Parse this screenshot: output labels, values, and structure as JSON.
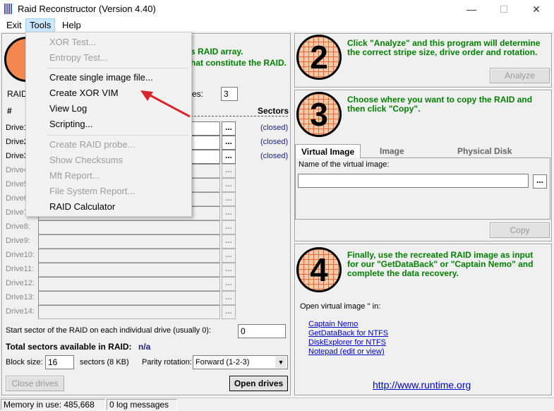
{
  "window": {
    "title": "Raid Reconstructor (Version 4.40)",
    "minimize": "—",
    "maximize": "☐",
    "close": "✕"
  },
  "menu": [
    "Exit",
    "Tools",
    "Help"
  ],
  "tools_menu": {
    "group1": [
      "XOR Test...",
      "Entropy Test..."
    ],
    "group2": [
      "Create single image file...",
      "Create XOR VIM",
      "View Log",
      "Scripting..."
    ],
    "group3": [
      "Create RAID probe...",
      "Show Checksums",
      "Mft Report...",
      "File System Report..."
    ],
    "calc": "RAID Calculator"
  },
  "step1": {
    "text_line1": "s RAID array.",
    "text_line2": "hat constitute the RAID.",
    "raid_label": "RAID",
    "drives_label": "es:",
    "drives_count": "3",
    "col_hash": "#",
    "col_sectors": "Sectors",
    "drives": [
      {
        "label": "Drive1",
        "status": "(closed)"
      },
      {
        "label": "Drive2",
        "status": "(closed)"
      },
      {
        "label": "Drive3",
        "status": "(closed)"
      },
      {
        "label": "Drive4",
        "status": ""
      },
      {
        "label": "Drive5",
        "status": ""
      },
      {
        "label": "Drive6",
        "status": ""
      },
      {
        "label": "Drive7",
        "status": ""
      },
      {
        "label": "Drive8:",
        "status": ""
      },
      {
        "label": "Drive9:",
        "status": ""
      },
      {
        "label": "Drive10:",
        "status": ""
      },
      {
        "label": "Drive11:",
        "status": ""
      },
      {
        "label": "Drive12:",
        "status": ""
      },
      {
        "label": "Drive13:",
        "status": ""
      },
      {
        "label": "Drive14:",
        "status": ""
      }
    ],
    "browse": "...",
    "start_sector_label": "Start sector of the RAID on each individual drive (usually 0):",
    "start_sector_value": "0",
    "total_label": "Total sectors available in RAID:",
    "total_value": "n/a",
    "block_size_label": "Block size:",
    "block_size_value": "16",
    "sectors_kb": "sectors (8 KB)",
    "parity_label": "Parity rotation:",
    "parity_value": "Forward (1-2-3)",
    "close_drives": "Close drives",
    "open_drives": "Open drives"
  },
  "step2": {
    "number": "2",
    "text": "Click \"Analyze\" and this program will determine the correct stripe size, drive order and rotation.",
    "analyze": "Analyze"
  },
  "step3": {
    "number": "3",
    "text": "Choose where you want to copy the RAID and then click \"Copy\".",
    "tabs": [
      "Virtual Image",
      "Image",
      "Physical Disk"
    ],
    "vi_label": "Name of the virtual image:",
    "vi_value": "",
    "browse": "...",
    "copy": "Copy"
  },
  "step4": {
    "number": "4",
    "text": "Finally, use the recreated RAID image as input for our \"GetDataBack\" or \"Captain Nemo\" and complete the data recovery.",
    "open_label": "Open virtual image '' in:",
    "links": [
      "Captain Nemo",
      "GetDataBack for NTFS",
      "DiskExplorer for NTFS",
      "Notepad (edit or view)"
    ],
    "url": "http://www.runtime.org"
  },
  "status": {
    "memory": "Memory in use: 485,668",
    "log": "0 log messages"
  },
  "colors": {
    "accent_green": "#008000",
    "circle_orange": "#f3874f",
    "arrow_red": "#d9262a"
  }
}
